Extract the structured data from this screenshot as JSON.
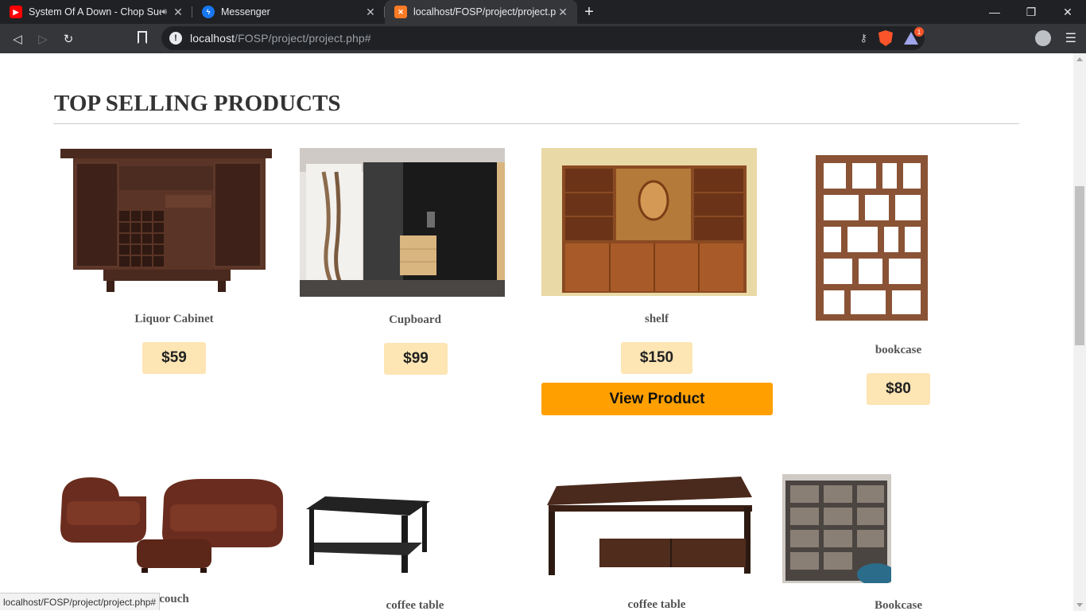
{
  "browser": {
    "tabs": [
      {
        "title": "System Of A Down - Chop Sue",
        "favicon": "youtube-icon",
        "audio": true,
        "active": false
      },
      {
        "title": "Messenger",
        "favicon": "messenger-icon",
        "audio": false,
        "active": false
      },
      {
        "title": "localhost/FOSP/project/project.php",
        "favicon": "xampp-icon",
        "audio": false,
        "active": true
      }
    ],
    "url_host": "localhost",
    "url_path": "/FOSP/project/project.php#",
    "rewards_badge": "1",
    "status_url": "localhost/FOSP/project/project.php#"
  },
  "page": {
    "heading": "TOP SELLING PRODUCTS",
    "view_button_label": "View Product",
    "products": [
      {
        "name": "Liquor Cabinet",
        "price": "$59"
      },
      {
        "name": "Cupboard",
        "price": "$99"
      },
      {
        "name": "shelf",
        "price": "$150"
      },
      {
        "name": "bookcase",
        "price": "$80"
      },
      {
        "name": "couch",
        "price": ""
      },
      {
        "name": "coffee table",
        "price": ""
      },
      {
        "name": "coffee table",
        "price": ""
      },
      {
        "name": "Bookcase",
        "price": ""
      }
    ]
  },
  "colors": {
    "price_bg": "#fde5b4",
    "view_button_bg": "#ffa000",
    "chrome_dark": "#202124",
    "chrome_toolbar": "#35363a"
  }
}
